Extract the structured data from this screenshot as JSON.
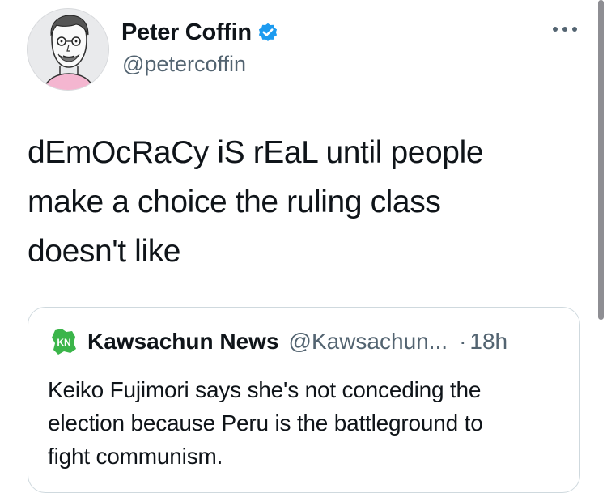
{
  "author": {
    "display_name": "Peter Coffin",
    "handle": "@petercoffin",
    "verified_icon": "verified-badge-icon"
  },
  "more_icon": "more-options-icon",
  "tweet": {
    "text_lines": [
      "dEmOcRaCy iS rEaL until people",
      "make a choice the ruling class",
      "doesn't like"
    ]
  },
  "quoted_tweet": {
    "display_name": "Kawsachun News",
    "handle": "@Kawsachun...",
    "separator": "·",
    "time": "18h",
    "avatar_text": "KN",
    "text_lines": [
      "Keiko Fujimori says she's not conceding the",
      "election because Peru is the battleground to",
      "fight communism."
    ]
  },
  "colors": {
    "text": "#0f1419",
    "secondary": "#536471",
    "verified": "#1d9bf0",
    "border": "#cfd9de",
    "kn_green": "#3bb54a"
  }
}
